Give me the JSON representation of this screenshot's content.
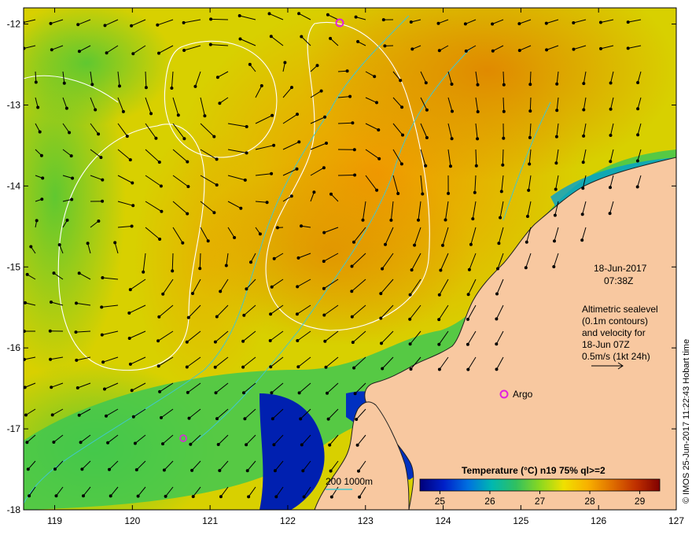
{
  "map": {
    "date": "18-Jun-2017",
    "time": "07:38Z",
    "description_lines": [
      "Altimetric sealevel",
      "(0.1m contours)",
      "and velocity for",
      "18-Jun 07Z",
      "0.5m/s (1kt 24h)"
    ],
    "argo_label": "Argo",
    "bathymetry_legend": "200  1000m",
    "colorbar_title": "Temperature (°C) n19 75% ql>=2",
    "colorbar_ticks": [
      "25",
      "26",
      "27",
      "28",
      "29"
    ],
    "colorbar_range": [
      24.6,
      29.4
    ],
    "colorbar_colors": [
      "#00007a",
      "#0020c8",
      "#0070e0",
      "#00b8b0",
      "#30c060",
      "#8ad820",
      "#f0e000",
      "#f8b000",
      "#e07000",
      "#c03000",
      "#800000"
    ],
    "credit": "© IMOS 25-Jun-2017 11:22:43 Hobart time",
    "lon_ticks": [
      "119",
      "120",
      "121",
      "122",
      "123",
      "124",
      "125",
      "126",
      "127"
    ],
    "lat_ticks": [
      "-12",
      "-13",
      "-14",
      "-15",
      "-16",
      "-17",
      "-18"
    ],
    "lon_range": [
      118.6,
      127.0
    ],
    "lat_range": [
      -18.0,
      -11.8
    ],
    "colors": {
      "land": "#f8c8a0",
      "ocean_warm": "#f0b000",
      "ocean_mid": "#d8e000",
      "ocean_cool": "#50c840",
      "coastal_cold": "#0040c0",
      "contour": "#ffffff",
      "bathy": "#40c8d0",
      "argo": "#e020e0",
      "arrow": "#000000"
    }
  }
}
